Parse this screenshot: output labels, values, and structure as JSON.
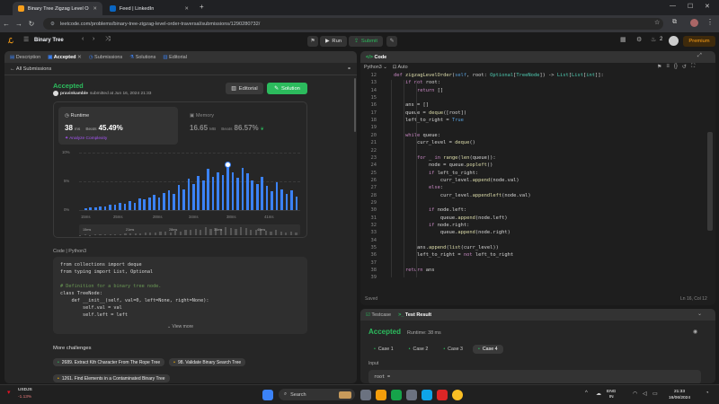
{
  "browser": {
    "tabs": [
      {
        "title": "Binary Tree Zigzag Level Order",
        "active": true
      },
      {
        "title": "Feed | LinkedIn",
        "active": false
      }
    ],
    "url": "leetcode.com/problems/binary-tree-zigzag-level-order-traversal/submissions/1290280732/"
  },
  "lc_header": {
    "problem_list": "Binary Tree",
    "run_label": "Run",
    "submit_label": "Submit",
    "streak": "2",
    "premium_label": "Premium"
  },
  "left_tabs": [
    "Description",
    "Accepted",
    "Submissions",
    "Solutions",
    "Editorial"
  ],
  "all_submissions": "All Submissions",
  "submission": {
    "status": "Accepted",
    "user": "pravinkamble",
    "submitted": "submitted at Jun 16, 2024 21:33",
    "editorial_btn": "Editorial",
    "solution_btn": "Solution",
    "runtime_label": "Runtime",
    "runtime_value": "38",
    "runtime_unit": "ms",
    "beats_label": "Beats",
    "runtime_beats": "45.49%",
    "analyze": "Analyze Complexity",
    "memory_label": "Memory",
    "memory_value": "16.65",
    "memory_unit": "MB",
    "memory_beats": "86.57%"
  },
  "histogram": {
    "y_labels": [
      "10%",
      "5%",
      "0%"
    ],
    "x_labels": [
      "15ms",
      "25ms",
      "28ms",
      "34ms",
      "38ms",
      "41ms"
    ],
    "values": [
      0.3,
      0.5,
      0.4,
      0.7,
      0.6,
      1.0,
      0.9,
      1.2,
      1.1,
      1.6,
      1.3,
      2.0,
      1.8,
      2.2,
      2.6,
      2.2,
      3.0,
      3.4,
      2.8,
      4.4,
      3.6,
      5.4,
      4.6,
      6.0,
      5.2,
      7.2,
      5.8,
      6.6,
      6.1,
      7.8,
      6.6,
      5.6,
      7.3,
      6.4,
      5.1,
      4.6,
      5.8,
      4.2,
      3.3,
      4.8,
      3.6,
      2.8,
      3.4,
      2.4
    ],
    "highlight_index": 29,
    "mini_labels": [
      "15ms",
      "21ms",
      "28ms",
      "34ms",
      "40ms"
    ]
  },
  "code_view": {
    "lang_path": "Code | Python3",
    "lines": [
      "from collections import deque",
      "from typing import List, Optional",
      "",
      "# Definition for a binary tree node.",
      "class TreeNode:",
      "    def __init__(self, val=0, left=None, right=None):",
      "        self.val = val",
      "        self.left = left"
    ],
    "view_more": "View more"
  },
  "more_challenges": {
    "title": "More challenges",
    "items": [
      "2689. Extract Kth Character From The Rope Tree",
      "98. Validate Binary Search Tree",
      "1261. Find Elements in a Contaminated Binary Tree"
    ]
  },
  "editor": {
    "title": "Code",
    "language": "Python3",
    "auto": "Auto",
    "saved": "Saved",
    "cursor": "Ln 16, Col 12",
    "line_numbers": [
      "12",
      "13",
      "14",
      "15",
      "16",
      "17",
      "18",
      "19",
      "20",
      "21",
      "22",
      "23",
      "24",
      "25",
      "26",
      "27",
      "28",
      "29",
      "30",
      "31",
      "32",
      "33",
      "34",
      "35",
      "36",
      "37",
      "38",
      "39"
    ]
  },
  "testresult": {
    "tab_testcase": "Testcase",
    "tab_result": "Test Result",
    "status": "Accepted",
    "runtime": "Runtime: 38 ms",
    "cases": [
      "Case 1",
      "Case 2",
      "Case 3",
      "Case 4"
    ],
    "input_label": "Input",
    "input_value": "root ="
  },
  "taskbar": {
    "stock_name": "USDJS",
    "stock_change": "-1.13%",
    "search_placeholder": "Search",
    "lang": "ENG",
    "region": "IN",
    "time": "21:33",
    "date": "16/06/2024"
  }
}
